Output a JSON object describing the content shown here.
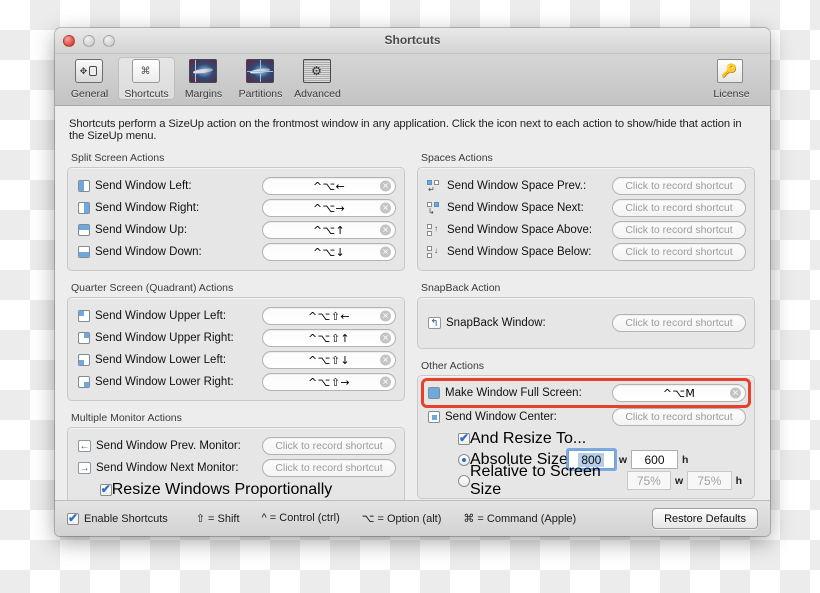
{
  "window": {
    "title": "Shortcuts",
    "controls": {
      "close": "close-button",
      "minimize": "minimize-button",
      "maximize": "maximize-button"
    }
  },
  "toolbar": {
    "items": [
      {
        "label": "General",
        "icon": "general-icon",
        "selected": false
      },
      {
        "label": "Shortcuts",
        "icon": "shortcuts-icon",
        "selected": true
      },
      {
        "label": "Margins",
        "icon": "margins-icon",
        "selected": false
      },
      {
        "label": "Partitions",
        "icon": "partitions-icon",
        "selected": false
      },
      {
        "label": "Advanced",
        "icon": "advanced-icon",
        "selected": false
      }
    ],
    "license": {
      "label": "License",
      "icon": "key-icon"
    }
  },
  "intro": "Shortcuts perform a SizeUp action on the frontmost window in any application. Click the icon next to each action to show/hide that action in the SizeUp menu.",
  "placeholder": "Click to record shortcut",
  "groups": {
    "split_screen": {
      "title": "Split Screen Actions",
      "rows": [
        {
          "label": "Send Window Left:",
          "icon": "window-left-icon",
          "shortcut": "^⌥←"
        },
        {
          "label": "Send Window Right:",
          "icon": "window-right-icon",
          "shortcut": "^⌥→"
        },
        {
          "label": "Send Window Up:",
          "icon": "window-up-icon",
          "shortcut": "^⌥↑"
        },
        {
          "label": "Send Window Down:",
          "icon": "window-down-icon",
          "shortcut": "^⌥↓"
        }
      ]
    },
    "quadrant": {
      "title": "Quarter Screen (Quadrant) Actions",
      "rows": [
        {
          "label": "Send Window Upper Left:",
          "icon": "window-upper-left-icon",
          "shortcut": "^⌥⇧←"
        },
        {
          "label": "Send Window Upper Right:",
          "icon": "window-upper-right-icon",
          "shortcut": "^⌥⇧↑"
        },
        {
          "label": "Send Window Lower Left:",
          "icon": "window-lower-left-icon",
          "shortcut": "^⌥⇧↓"
        },
        {
          "label": "Send Window Lower Right:",
          "icon": "window-lower-right-icon",
          "shortcut": "^⌥⇧→"
        }
      ]
    },
    "multiple_monitor": {
      "title": "Multiple Monitor Actions",
      "rows": [
        {
          "label": "Send Window Prev. Monitor:",
          "icon": "arrow-left-box-icon",
          "shortcut": ""
        },
        {
          "label": "Send Window Next Monitor:",
          "icon": "arrow-right-box-icon",
          "shortcut": ""
        }
      ],
      "resize_proportionally": {
        "label": "Resize Windows Proportionally",
        "checked": true
      }
    },
    "spaces": {
      "title": "Spaces Actions",
      "rows": [
        {
          "label": "Send Window Space Prev.:",
          "icon": "space-prev-icon",
          "shortcut": ""
        },
        {
          "label": "Send Window Space Next:",
          "icon": "space-next-icon",
          "shortcut": ""
        },
        {
          "label": "Send Window Space Above:",
          "icon": "space-above-icon",
          "shortcut": ""
        },
        {
          "label": "Send Window Space Below:",
          "icon": "space-below-icon",
          "shortcut": ""
        }
      ]
    },
    "snapback": {
      "title": "SnapBack Action",
      "rows": [
        {
          "label": "SnapBack Window:",
          "icon": "snapback-icon",
          "shortcut": ""
        }
      ]
    },
    "other": {
      "title": "Other Actions",
      "full_screen": {
        "label": "Make Window Full Screen:",
        "icon": "window-full-icon",
        "shortcut": "^⌥M",
        "highlighted": true
      },
      "center": {
        "label": "Send Window Center:",
        "icon": "window-center-icon",
        "shortcut": ""
      },
      "and_resize": {
        "label": "And Resize To...",
        "checked": true
      },
      "absolute": {
        "label": "Absolute Size",
        "selected": true,
        "width": "800",
        "height": "600"
      },
      "relative": {
        "label": "Relative to Screen Size",
        "selected": false,
        "width": "75%",
        "height": "75%"
      },
      "unit_w": "w",
      "unit_h": "h"
    }
  },
  "footer": {
    "enable_shortcuts": {
      "label": "Enable Shortcuts",
      "checked": true
    },
    "legend": [
      "⇧ = Shift",
      "^ = Control (ctrl)",
      "⌥ = Option (alt)",
      "⌘ = Command (Apple)"
    ],
    "restore_defaults": "Restore Defaults"
  },
  "colors": {
    "highlight": "#e8402a",
    "accent": "#2d6fce",
    "icon_fill": "#6ea8dd"
  }
}
